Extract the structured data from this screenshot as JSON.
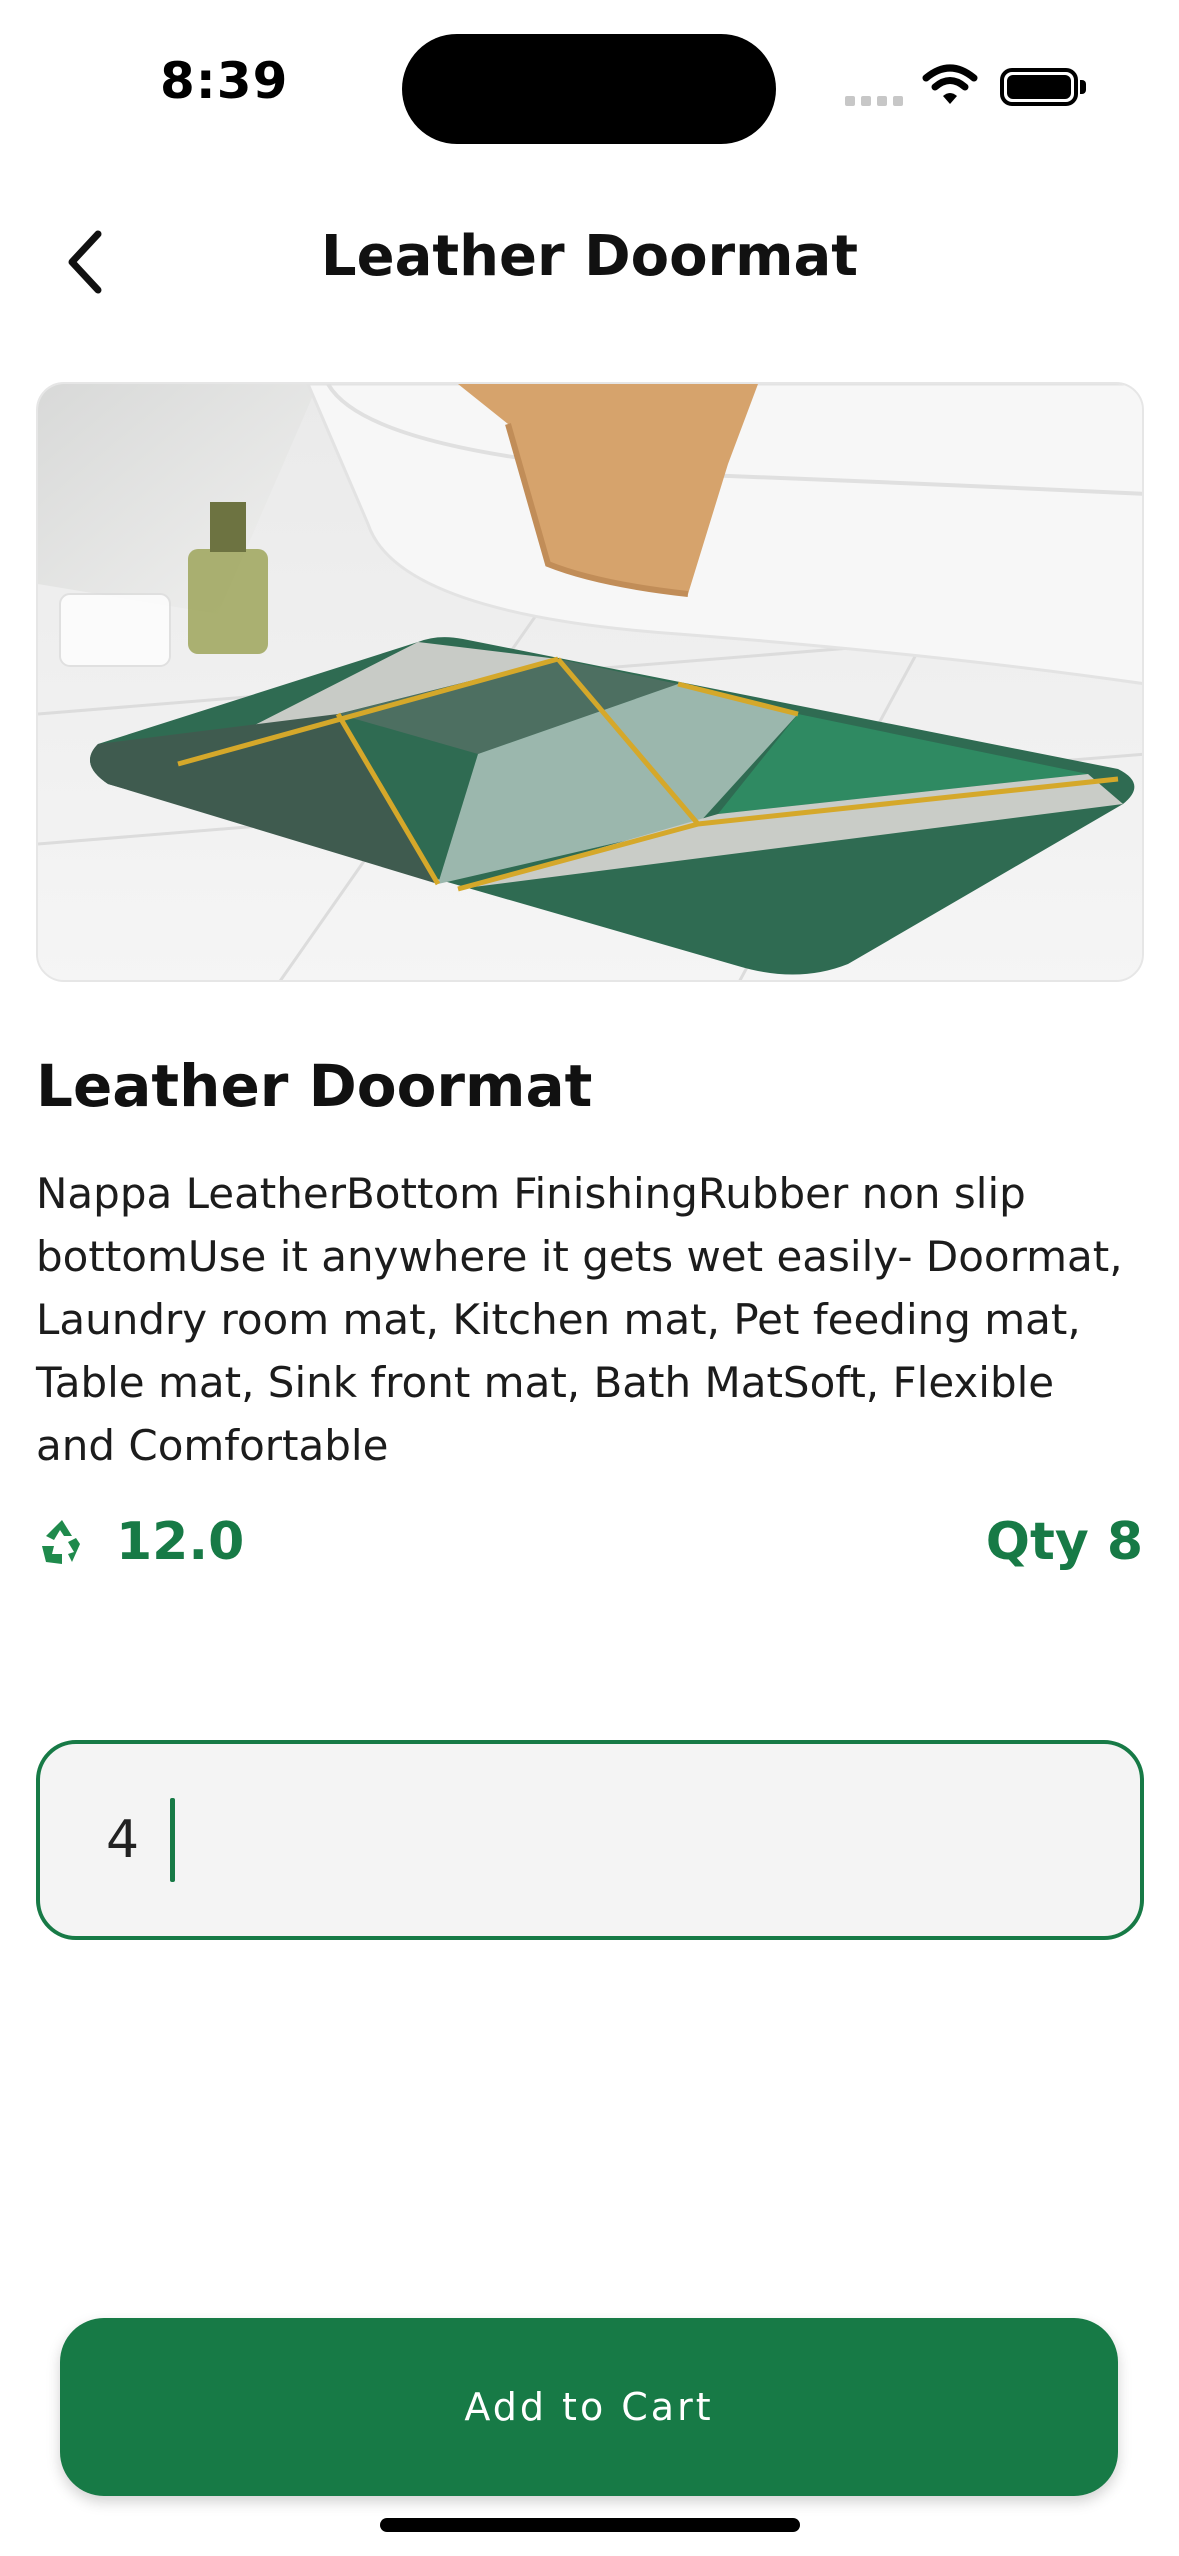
{
  "status_bar": {
    "time": "8:39"
  },
  "header": {
    "title": "Leather Doormat",
    "back_icon": "chevron-left-icon"
  },
  "product": {
    "image_alt": "Leather Doormat",
    "title": "Leather Doormat",
    "description": "Nappa LeatherBottom FinishingRubber non slip bottomUse it anywhere it gets wet easily- Doormat, Laundry room mat, Kitchen mat, Pet feeding mat, Table mat, Sink front mat, Bath MatSoft, Flexible and Comfortable",
    "points_icon": "recycle-icon",
    "points": "12.0",
    "qty_label": "Qty 8"
  },
  "quantity_input": {
    "value": "4"
  },
  "actions": {
    "add_to_cart": "Add to Cart"
  },
  "colors": {
    "accent": "#177a46",
    "input_bg": "#f4f4f4"
  }
}
